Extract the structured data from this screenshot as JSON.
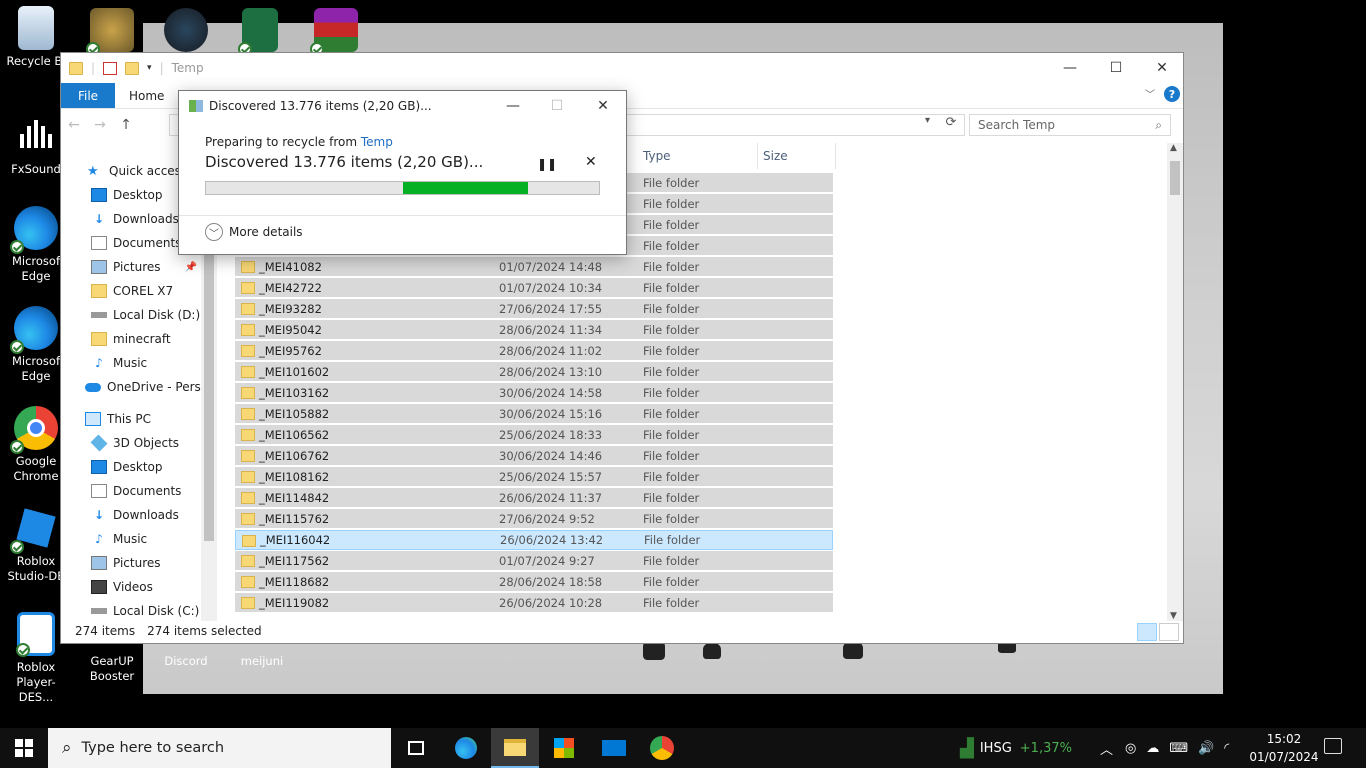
{
  "desktop": {
    "icons": [
      {
        "label": "Recycle Bin",
        "name": "recycle-bin"
      },
      {
        "label": "FxSound",
        "name": "fxsound"
      },
      {
        "label": "Microsoft Edge",
        "name": "microsoft-edge"
      },
      {
        "label": "Microsoft Edge",
        "name": "microsoft-edge-2"
      },
      {
        "label": "Google Chrome",
        "name": "google-chrome"
      },
      {
        "label": "Roblox Studio-DE...",
        "name": "roblox-studio"
      },
      {
        "label": "Roblox Player-DES...",
        "name": "roblox-player"
      },
      {
        "label": "GearUP Booster",
        "name": "gearup-booster"
      },
      {
        "label": "Discord",
        "name": "discord"
      },
      {
        "label": "meijuni",
        "name": "meijuni"
      }
    ],
    "recycle_bin_label": "Recycle Bi",
    "fxsound_label": "FxSound",
    "edge1_label": "Microsoft\nEdge",
    "edge1_line1": "Microsof",
    "edge1_line2": "Edge",
    "edge2_line1": "Microsof",
    "edge2_line2": "Edge",
    "chrome_line1": "Google",
    "chrome_line2": "Chrome",
    "rstudio_line1": "Roblox",
    "rstudio_line2": "Studio-DE",
    "rplayer_line1": "Roblox",
    "rplayer_line2": "Player-DES...",
    "gearup_line1": "GearUP",
    "gearup_line2": "Booster",
    "discord_label": "Discord",
    "meijuni_label": "meijuni"
  },
  "explorer": {
    "title": "Temp",
    "ribbon": {
      "file": "File",
      "home": "Home"
    },
    "search_placeholder": "Search Temp",
    "sidebar": {
      "quick_access": "Quick access",
      "items": [
        {
          "label": "Desktop",
          "icon": "desktop-icon"
        },
        {
          "label": "Downloads",
          "icon": "downloads-icon"
        },
        {
          "label": "Documents",
          "icon": "documents-icon"
        },
        {
          "label": "Pictures",
          "icon": "pictures-icon"
        },
        {
          "label": "COREL X7",
          "icon": "folder-icon"
        },
        {
          "label": "Local Disk (D:)",
          "icon": "drive-icon"
        },
        {
          "label": "minecraft",
          "icon": "folder-icon"
        },
        {
          "label": "Music",
          "icon": "music-icon"
        }
      ],
      "onedrive": "OneDrive - Persor",
      "this_pc": "This PC",
      "pc_items": [
        {
          "label": "3D Objects",
          "icon": "3d-objects-icon"
        },
        {
          "label": "Desktop",
          "icon": "desktop-icon"
        },
        {
          "label": "Documents",
          "icon": "documents-icon"
        },
        {
          "label": "Downloads",
          "icon": "downloads-icon"
        },
        {
          "label": "Music",
          "icon": "music-icon"
        },
        {
          "label": "Pictures",
          "icon": "pictures-icon"
        },
        {
          "label": "Videos",
          "icon": "videos-icon"
        },
        {
          "label": "Local Disk (C:)",
          "icon": "drive-icon"
        }
      ]
    },
    "columns": {
      "type": "Type",
      "size": "Size"
    },
    "rows": [
      {
        "name": "",
        "date": "",
        "type": "File folder"
      },
      {
        "name": "",
        "date": "",
        "type": "File folder"
      },
      {
        "name": "",
        "date": "",
        "type": "File folder"
      },
      {
        "name": "",
        "date": "",
        "type": "File folder"
      },
      {
        "name": "_MEI41082",
        "date": "01/07/2024 14:48",
        "type": "File folder"
      },
      {
        "name": "_MEI42722",
        "date": "01/07/2024 10:34",
        "type": "File folder"
      },
      {
        "name": "_MEI93282",
        "date": "27/06/2024 17:55",
        "type": "File folder"
      },
      {
        "name": "_MEI95042",
        "date": "28/06/2024 11:34",
        "type": "File folder"
      },
      {
        "name": "_MEI95762",
        "date": "28/06/2024 11:02",
        "type": "File folder"
      },
      {
        "name": "_MEI101602",
        "date": "28/06/2024 13:10",
        "type": "File folder"
      },
      {
        "name": "_MEI103162",
        "date": "30/06/2024 14:58",
        "type": "File folder"
      },
      {
        "name": "_MEI105882",
        "date": "30/06/2024 15:16",
        "type": "File folder"
      },
      {
        "name": "_MEI106562",
        "date": "25/06/2024 18:33",
        "type": "File folder"
      },
      {
        "name": "_MEI106762",
        "date": "30/06/2024 14:46",
        "type": "File folder"
      },
      {
        "name": "_MEI108162",
        "date": "25/06/2024 15:57",
        "type": "File folder"
      },
      {
        "name": "_MEI114842",
        "date": "26/06/2024 11:37",
        "type": "File folder"
      },
      {
        "name": "_MEI115762",
        "date": "27/06/2024 9:52",
        "type": "File folder"
      },
      {
        "name": "_MEI116042",
        "date": "26/06/2024 13:42",
        "type": "File folder",
        "selected": true
      },
      {
        "name": "_MEI117562",
        "date": "01/07/2024 9:27",
        "type": "File folder"
      },
      {
        "name": "_MEI118682",
        "date": "28/06/2024 18:58",
        "type": "File folder"
      },
      {
        "name": "_MEI119082",
        "date": "26/06/2024 10:28",
        "type": "File folder"
      }
    ],
    "status": {
      "items": "274 items",
      "selected": "274 items selected"
    }
  },
  "dialog": {
    "title": "Discovered 13.776 items (2,20 GB)...",
    "subtitle_prefix": "Preparing to recycle from ",
    "subtitle_link": "Temp",
    "main": "Discovered 13.776 items (2,20 GB)...",
    "more_details": "More details",
    "progress": {
      "start": 0.5,
      "end": 0.82
    },
    "accent": "#06b025"
  },
  "taskbar": {
    "search_placeholder": "Type here to search",
    "stock_name": "IHSG",
    "stock_change": "+1,37%",
    "time": "15:02",
    "date": "01/07/2024"
  }
}
